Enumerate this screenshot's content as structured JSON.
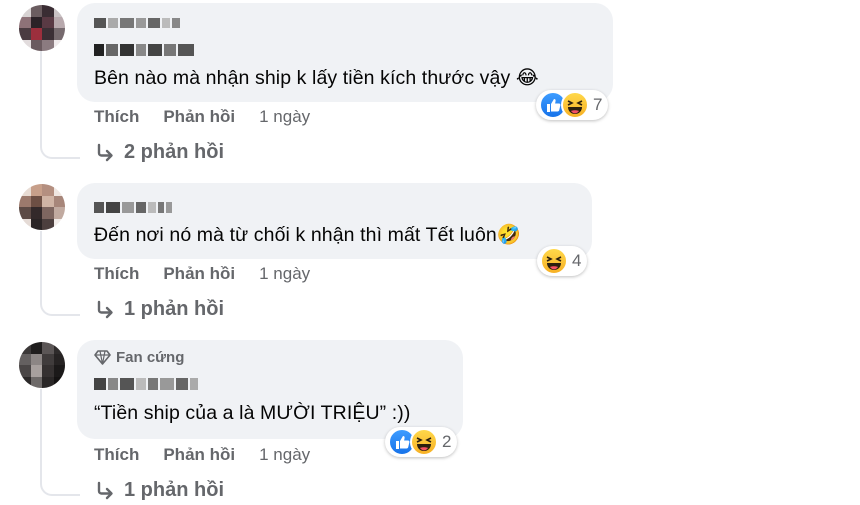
{
  "comments": [
    {
      "text": "Bên nào mà nhận ship k lấy tiền kích thước vậy 😂",
      "reaction_count": "7",
      "reaction_icons": [
        "like-icon",
        "haha-icon"
      ],
      "like_label": "Thích",
      "reply_label": "Phản hồi",
      "timestamp": "1 ngày",
      "view_replies": "2 phản hồi"
    },
    {
      "text": "Đến nơi nó mà từ chối k nhận thì mất Tết luôn🤣",
      "reaction_count": "4",
      "reaction_icons": [
        "haha-icon"
      ],
      "like_label": "Thích",
      "reply_label": "Phản hồi",
      "timestamp": "1 ngày",
      "view_replies": "1 phản hồi"
    },
    {
      "badge": "Fan cứng",
      "text": "“Tiền ship của a là MƯỜI TRIỆU” :))",
      "reaction_count": "2",
      "reaction_icons": [
        "like-icon",
        "haha-icon"
      ],
      "like_label": "Thích",
      "reply_label": "Phản hồi",
      "timestamp": "1 ngày",
      "view_replies": "1 phản hồi"
    }
  ],
  "colors": {
    "bubble": "#f0f2f5",
    "secondary_text": "#65676b",
    "like_blue": "#1877f2",
    "haha_yellow": "#f7b928"
  }
}
